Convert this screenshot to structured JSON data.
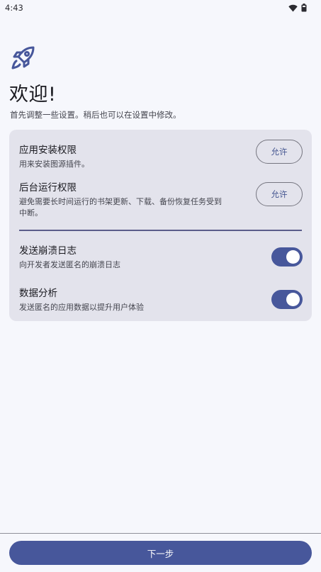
{
  "status_bar": {
    "time": "4:43",
    "icons": [
      "wifi-icon",
      "battery-icon"
    ]
  },
  "header": {
    "icon": "rocket-icon",
    "title": "欢迎!",
    "subtitle": "首先调整一些设置。稍后也可以在设置中修改。"
  },
  "permissions": {
    "install": {
      "title": "应用安装权限",
      "description": "用来安装图源插件。",
      "button_label": "允许"
    },
    "background": {
      "title": "后台运行权限",
      "description_line1": "避免需要长时间运行的书架更新、下载、备份恢复任务受到",
      "description_line2": "中断。",
      "button_label": "允许"
    }
  },
  "settings": {
    "crash_logs": {
      "title": "发送崩溃日志",
      "description": "向开发者发送匿名的崩溃日志",
      "enabled": true
    },
    "analytics": {
      "title": "数据分析",
      "description": "发送匿名的应用数据以提升用户体验",
      "enabled": true
    }
  },
  "footer": {
    "next_label": "下一步"
  },
  "colors": {
    "accent": "#47579b",
    "background": "#f6f7fc",
    "card": "#e3e3ec"
  }
}
